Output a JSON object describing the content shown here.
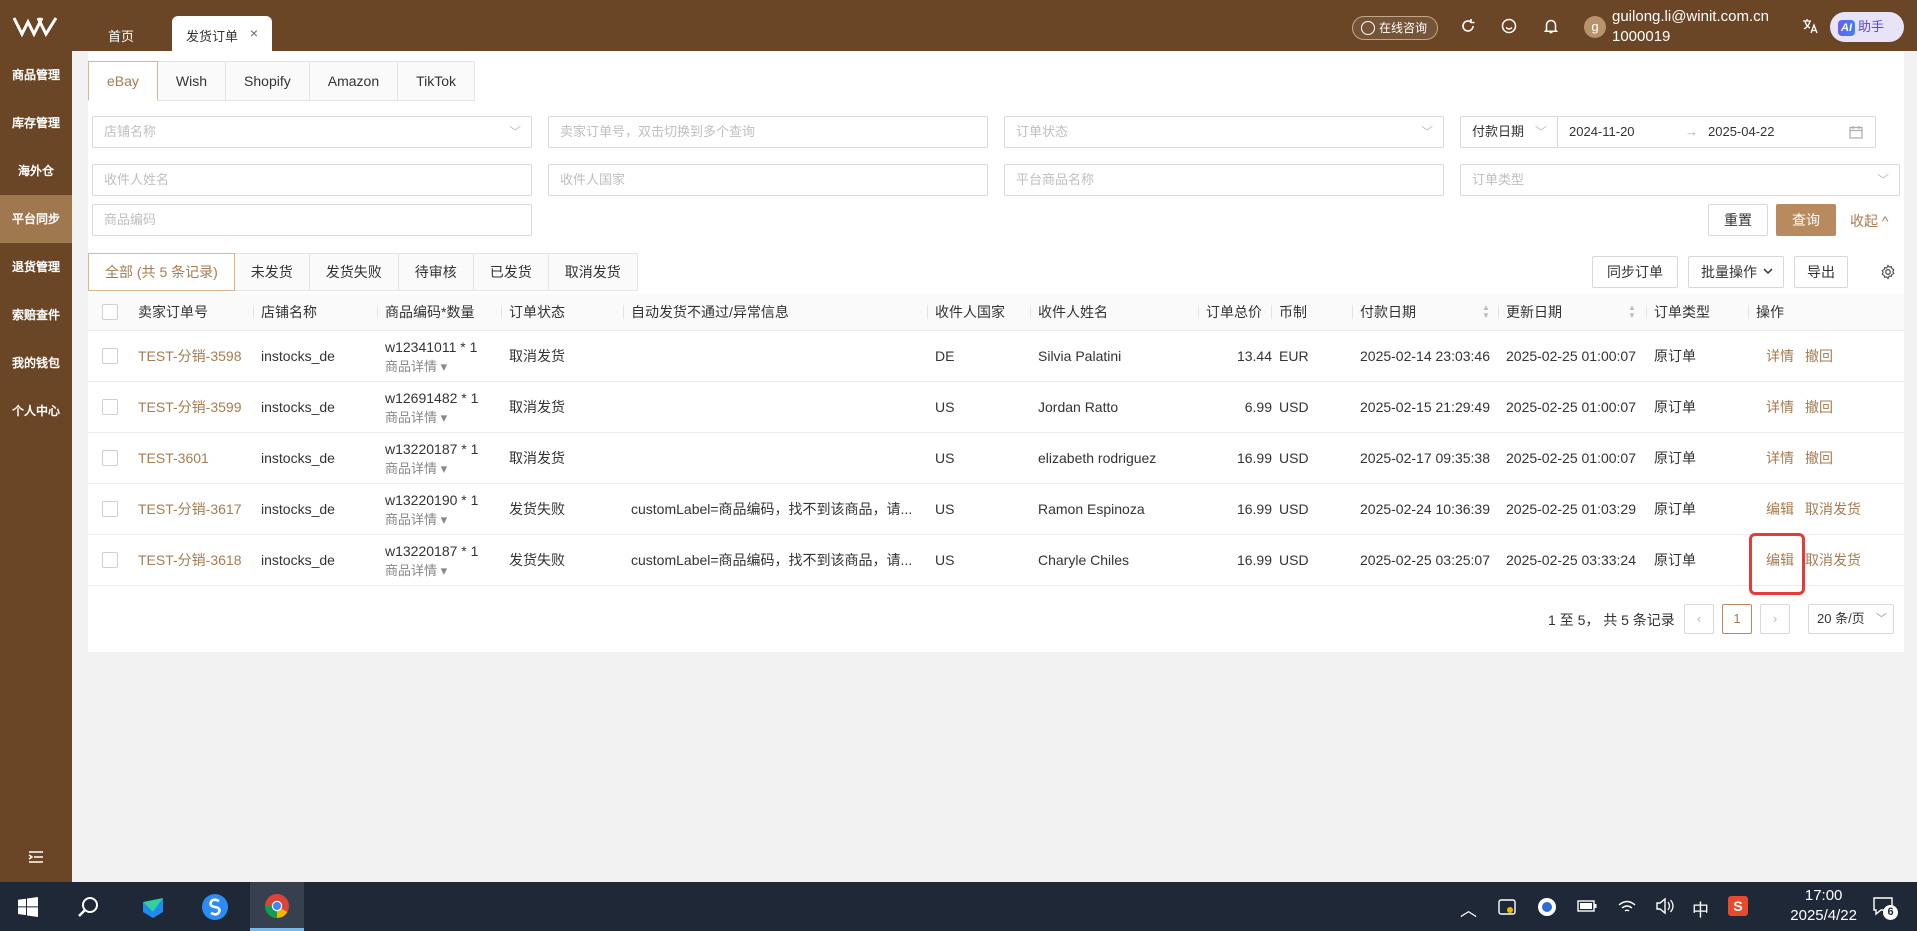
{
  "topbar": {
    "home_tab": "首页",
    "active_tab": "发货订单",
    "close_glyph": "×",
    "consult": "在线咨询",
    "avatar_letter": "g",
    "user_email": "guilong.li@winit.com.cn",
    "user_id": "1000019",
    "assistant_ai": "AI",
    "assistant_label": "助手"
  },
  "sidebar": {
    "items": [
      {
        "label": "商品管理"
      },
      {
        "label": "库存管理"
      },
      {
        "label": "海外仓"
      },
      {
        "label": "平台同步"
      },
      {
        "label": "退货管理"
      },
      {
        "label": "索赔查件"
      },
      {
        "label": "我的钱包"
      },
      {
        "label": "个人中心"
      }
    ]
  },
  "platform_tabs": [
    "eBay",
    "Wish",
    "Shopify",
    "Amazon",
    "TikTok"
  ],
  "filters": {
    "store_name": "店铺名称",
    "seller_order": "卖家订单号，双击切换到多个查询",
    "order_status": "订单状态",
    "date_type": "付款日期",
    "date_from": "2024-11-20",
    "date_to": "2025-04-22",
    "date_arrow": "→",
    "receiver_name": "收件人姓名",
    "receiver_country": "收件人国家",
    "platform_product": "平台商品名称",
    "order_type": "订单类型",
    "product_code": "商品编码",
    "reset": "重置",
    "search": "查询",
    "collapse": "收起 ^"
  },
  "status_tabs": [
    "全部 (共 5 条记录)",
    "未发货",
    "发货失败",
    "待审核",
    "已发货",
    "取消发货"
  ],
  "toolbar": {
    "sync": "同步订单",
    "batch": "批量操作",
    "export": "导出"
  },
  "table": {
    "headers": {
      "seller_order": "卖家订单号",
      "store": "店铺名称",
      "sku_qty": "商品编码*数量",
      "status": "订单状态",
      "error": "自动发货不通过/异常信息",
      "country": "收件人国家",
      "receiver": "收件人姓名",
      "total": "订单总价",
      "currency": "币制",
      "pay_date": "付款日期",
      "update_date": "更新日期",
      "type": "订单类型",
      "actions": "操作"
    },
    "sku_detail_label": "商品详情",
    "rows": [
      {
        "order": "TEST-分销-3598",
        "store": "instocks_de",
        "sku": "w12341011 * 1",
        "status": "取消发货",
        "error": "",
        "country": "DE",
        "receiver": "Silvia Palatini",
        "total": "13.44",
        "currency": "EUR",
        "pay_date": "2025-02-14 23:03:46",
        "update_date": "2025-02-25 01:00:07",
        "type": "原订单",
        "action1": "详情",
        "action2": "撤回"
      },
      {
        "order": "TEST-分销-3599",
        "store": "instocks_de",
        "sku": "w12691482 * 1",
        "status": "取消发货",
        "error": "",
        "country": "US",
        "receiver": "Jordan Ratto",
        "total": "6.99",
        "currency": "USD",
        "pay_date": "2025-02-15 21:29:49",
        "update_date": "2025-02-25 01:00:07",
        "type": "原订单",
        "action1": "详情",
        "action2": "撤回"
      },
      {
        "order": "TEST-3601",
        "store": "instocks_de",
        "sku": "w13220187 * 1",
        "status": "取消发货",
        "error": "",
        "country": "US",
        "receiver": "elizabeth rodriguez",
        "total": "16.99",
        "currency": "USD",
        "pay_date": "2025-02-17 09:35:38",
        "update_date": "2025-02-25 01:00:07",
        "type": "原订单",
        "action1": "详情",
        "action2": "撤回"
      },
      {
        "order": "TEST-分销-3617",
        "store": "instocks_de",
        "sku": "w13220190 * 1",
        "status": "发货失败",
        "error": "customLabel=商品编码，找不到该商品，请...",
        "country": "US",
        "receiver": "Ramon Espinoza",
        "total": "16.99",
        "currency": "USD",
        "pay_date": "2025-02-24 10:36:39",
        "update_date": "2025-02-25 01:03:29",
        "type": "原订单",
        "action1": "编辑",
        "action2": "取消发货"
      },
      {
        "order": "TEST-分销-3618",
        "store": "instocks_de",
        "sku": "w13220187 * 1",
        "status": "发货失败",
        "error": "customLabel=商品编码，找不到该商品，请...",
        "country": "US",
        "receiver": "Charyle Chiles",
        "total": "16.99",
        "currency": "USD",
        "pay_date": "2025-02-25 03:25:07",
        "update_date": "2025-02-25 03:33:24",
        "type": "原订单",
        "action1": "编辑",
        "action2": "取消发货"
      }
    ]
  },
  "pagination": {
    "summary": "1 至 5，  共 5 条记录",
    "current": "1",
    "page_size": "20 条/页"
  },
  "taskbar": {
    "ime": "中",
    "time": "17:00",
    "date": "2025/4/22",
    "notification_count": "6"
  },
  "colors": {
    "brand": "#6b4626",
    "accent": "#a67c52",
    "highlight": "#e63b3b"
  }
}
